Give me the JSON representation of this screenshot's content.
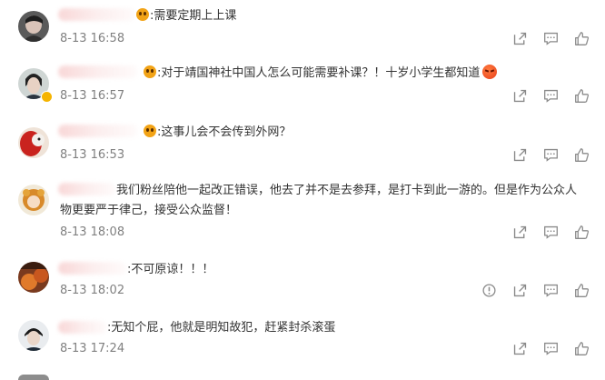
{
  "comments": [
    {
      "text": ":需要定期上上课",
      "time": "8-13 16:58",
      "has_report": false
    },
    {
      "text": ":对于靖国神社中国人怎么可能需要补课？！十岁小学生都知道",
      "time": "8-13 16:57",
      "has_report": false
    },
    {
      "text": ":这事儿会不会传到外网？",
      "time": "8-13 16:53",
      "has_report": false
    },
    {
      "text": "我们粉丝陪他一起改正错误，他去了并不是去参拜，是打卡到此一游的。但是作为公众人物更要严于律己，接受公众监督！",
      "time": "8-13 18:08",
      "has_report": false
    },
    {
      "text": ":不可原谅！！！",
      "time": "8-13 18:02",
      "has_report": true
    },
    {
      "text": ":无知个屁，他就是明知故犯，赶紧封杀滚蛋",
      "time": "8-13 17:24",
      "has_report": false
    }
  ],
  "icons": {
    "forward": "share-icon",
    "comment": "comment-icon",
    "like": "thumbs-up-icon",
    "report": "warning-icon"
  },
  "colors": {
    "icon": "#8a8a8a",
    "time": "#808080",
    "text": "#333333"
  }
}
